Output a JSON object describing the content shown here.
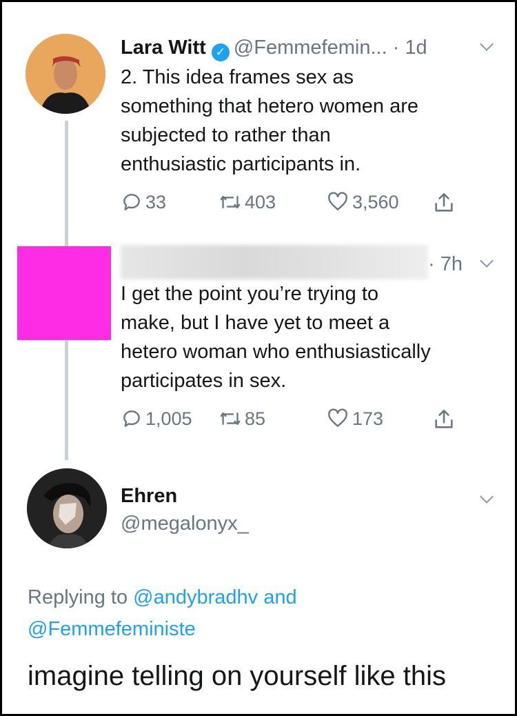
{
  "tweets": [
    {
      "author_name": "Lara Witt",
      "verified": true,
      "handle": "@Femmefemin...",
      "time": "· 1d",
      "text_lines": [
        "2. This idea frames sex as",
        "something that hetero women are",
        "subjected to rather than",
        "enthusiastic participants in."
      ],
      "replies": "33",
      "retweets": "403",
      "likes": "3,560"
    },
    {
      "time": "· 7h",
      "text_lines": [
        "I get the point you’re trying to",
        "make, but I have yet to meet a",
        "hetero woman who enthusiastically",
        "participates in sex."
      ],
      "replies": "1,005",
      "retweets": "85",
      "likes": "173"
    }
  ],
  "reply": {
    "author_name": "Ehren",
    "handle": "@megalonyx_",
    "replying_prefix": "Replying to",
    "replying_user_1": "@andybradhv",
    "replying_and": "and",
    "replying_user_2": "@Femmefeministe",
    "text": "imagine telling on yourself like this"
  },
  "icons": {
    "reply": "reply-icon",
    "retweet": "retweet-icon",
    "like": "heart-icon",
    "share": "share-icon",
    "verified": "verified-badge-icon",
    "menu": "chevron-down-icon"
  },
  "colors": {
    "text": "#14171a",
    "muted": "#657786",
    "link": "#1da1f2",
    "verified": "#1da1f2",
    "redaction": "#ff2ce6"
  }
}
